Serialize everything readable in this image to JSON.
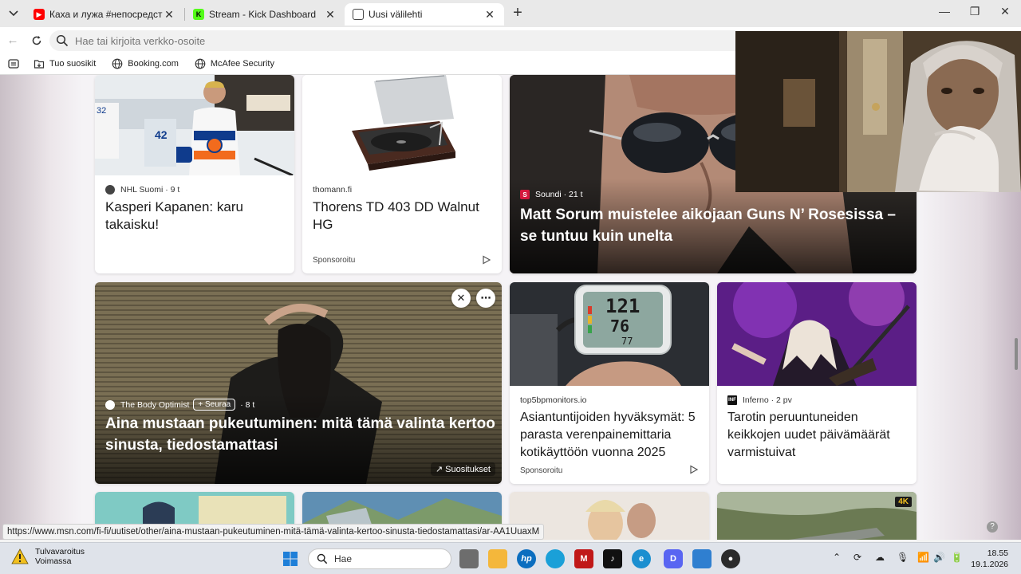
{
  "tabs": [
    {
      "title": "Каха и лужа #непосредственно",
      "favicon": "youtube-icon",
      "color": "#ff0000"
    },
    {
      "title": "Stream - Kick Dashboard",
      "favicon": "kick-icon",
      "color": "#53fc18"
    },
    {
      "title": "Uusi välilehti",
      "favicon": "new-tab-icon",
      "color": "#444444"
    }
  ],
  "address_bar": {
    "placeholder": "Hae tai kirjoita verkko-osoite"
  },
  "bookmarks": [
    {
      "label": "Tuo suosikit",
      "icon": "import-favorites-icon"
    },
    {
      "label": "Booking.com",
      "icon": "globe-icon"
    },
    {
      "label": "McAfee Security",
      "icon": "globe-icon"
    }
  ],
  "feed": {
    "card_hockey": {
      "source": "NHL Suomi",
      "age": "9 t",
      "title": "Kasperi Kapanen: karu takaisku!"
    },
    "card_thomann": {
      "source": "thomann.fi",
      "title": "Thorens TD 403 DD Walnut HG",
      "sponsored": "Sponsoroitu"
    },
    "card_soundi": {
      "source": "Soundi",
      "age": "21 t",
      "title": "Matt Sorum muistelee aikojaan Guns N’ Rosesissa – se tuntuu kuin unelta"
    },
    "card_body": {
      "source": "The Body Optimist",
      "follow": "Seuraa",
      "age": "8 t",
      "title": "Aina mustaan pukeutuminen: mitä tämä valinta kertoo sinusta, tiedostamattasi",
      "trending": "Suositukset"
    },
    "card_bp": {
      "source": "top5bpmonitors.io",
      "title": "Asiantuntijoiden hyväksymät: 5 parasta verenpainemittaria kotikäyttöön vuonna 2025",
      "sponsored": "Sponsoroitu",
      "readout": [
        "121",
        "76",
        "77"
      ]
    },
    "card_inferno": {
      "source": "Inferno",
      "source_logo": "INF",
      "age": "2 pv",
      "title": "Tarotin peruuntuneiden keikkojen uudet päivämäärät varmistuivat"
    },
    "card_4k": {
      "badge": "4K"
    }
  },
  "status_url": "https://www.msn.com/fi-fi/uutiset/other/aina-mustaan-pukeutuminen-mitä-tämä-valinta-kertoo-sinusta-tiedostamattasi/ar-AA1UuaxM",
  "taskbar": {
    "weather_title": "Tulvavaroitus",
    "weather_sub": "Voimassa",
    "search_placeholder": "Hae",
    "time": "18.55",
    "date": "19.1.2026"
  }
}
